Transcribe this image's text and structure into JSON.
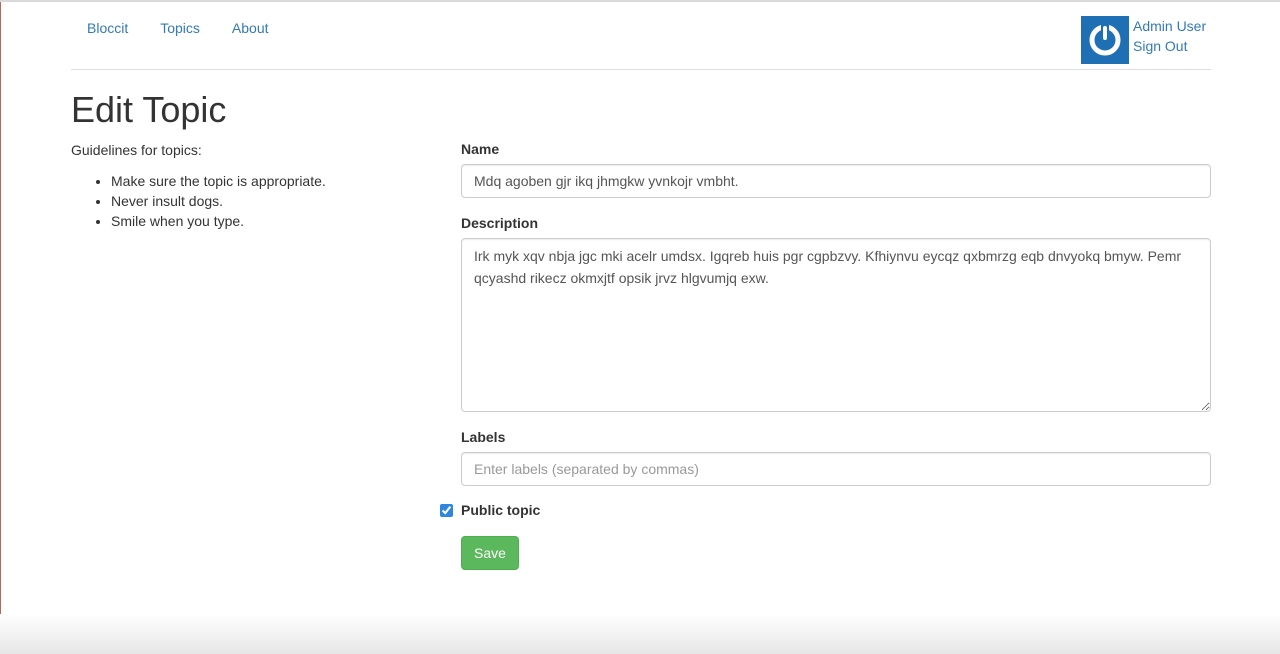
{
  "nav": {
    "links": [
      "Bloccit",
      "Topics",
      "About"
    ],
    "user_name": "Admin User",
    "sign_out": "Sign Out"
  },
  "page": {
    "title": "Edit Topic"
  },
  "guidelines": {
    "heading": "Guidelines for topics:",
    "items": [
      "Make sure the topic is appropriate.",
      "Never insult dogs.",
      "Smile when you type."
    ]
  },
  "form": {
    "name_label": "Name",
    "name_value": "Mdq agoben gjr ikq jhmgkw yvnkojr vmbht.",
    "description_label": "Description",
    "description_value": "Irk myk xqv nbja jgc mki acelr umdsx. Igqreb huis pgr cgpbzvy. Kfhiynvu eycqz qxbmrzg eqb dnvyokq bmyw. Pemr qcyashd rikecz okmxjtf opsik jrvz hlgvumjq exw.",
    "labels_label": "Labels",
    "labels_placeholder": "Enter labels (separated by commas)",
    "labels_value": "",
    "public_label": "Public topic",
    "public_checked": true,
    "save_label": "Save"
  },
  "colors": {
    "link": "#337ab7",
    "save_button": "#5cb85c",
    "avatar": "#1f6fb5"
  },
  "icons": {
    "avatar": "power-icon"
  }
}
